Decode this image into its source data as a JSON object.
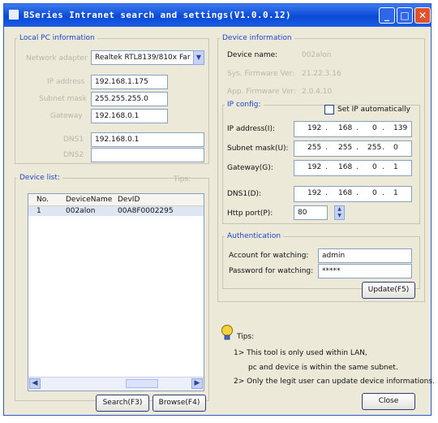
{
  "window": {
    "title": "BSeries Intranet search and settings(V1.0.0.12)",
    "minimize_glyph": "_",
    "maximize_glyph": "□",
    "close_glyph": "✕"
  },
  "local_pc": {
    "legend": "Local PC information",
    "adapter_label": "Network adapter",
    "adapter_value": "Realtek RTL8139/810x Far",
    "ip_label": "IP address",
    "ip_value": "192.168.1.175",
    "mask_label": "Subnet mask",
    "mask_value": "255.255.255.0",
    "gateway_label": "Gateway",
    "gateway_value": "192.168.0.1",
    "dns_label": "DNS1",
    "dns_value": "192.168.0.1",
    "dns2_label": "DNS2",
    "dns2_value": ""
  },
  "device_list": {
    "legend": "Device list:",
    "count_text": "Tips:",
    "columns": [
      "No.",
      "DeviceName",
      "DevID"
    ],
    "rows": [
      {
        "no": "1",
        "name": "002alon",
        "id": "00A8F0002295"
      }
    ],
    "search_button": "Search(F3)",
    "browse_button": "Browse(F4)"
  },
  "device_info": {
    "legend": "Device information",
    "name_label": "Device name:",
    "name_value": "002alon",
    "sys_fw_label": "Sys. Firmware Ver:",
    "sys_fw_value": "21.22.3.16",
    "app_fw_label": "App. Firmware Ver:",
    "app_fw_value": "2.0.4.10"
  },
  "ip_config": {
    "legend": "IP config:",
    "auto_label": "Set IP automatically",
    "auto_checked": false,
    "ip_label": "IP address(I):",
    "ip": [
      "192",
      "168",
      "0",
      "139"
    ],
    "mask_label": "Subnet mask(U):",
    "mask": [
      "255",
      "255",
      "255",
      "0"
    ],
    "gateway_label": "Gateway(G):",
    "gateway": [
      "192",
      "168",
      "0",
      "1"
    ],
    "dns_label": "DNS1(D):",
    "dns": [
      "192",
      "168",
      "0",
      "1"
    ],
    "port_label": "Http port(P):",
    "port_value": "80"
  },
  "auth": {
    "legend": "Authentication",
    "account_label": "Account for watching:",
    "account_value": "admin",
    "password_label": "Password for watching:",
    "password_value": "*****",
    "update_button": "Update(F5)"
  },
  "tips": {
    "title": "Tips:",
    "line1": "1> This tool is only used within LAN,",
    "line2": "pc and device is within the same subnet.",
    "line3": "2> Only the legit user can update  device informations.",
    "close_button": "Close"
  }
}
